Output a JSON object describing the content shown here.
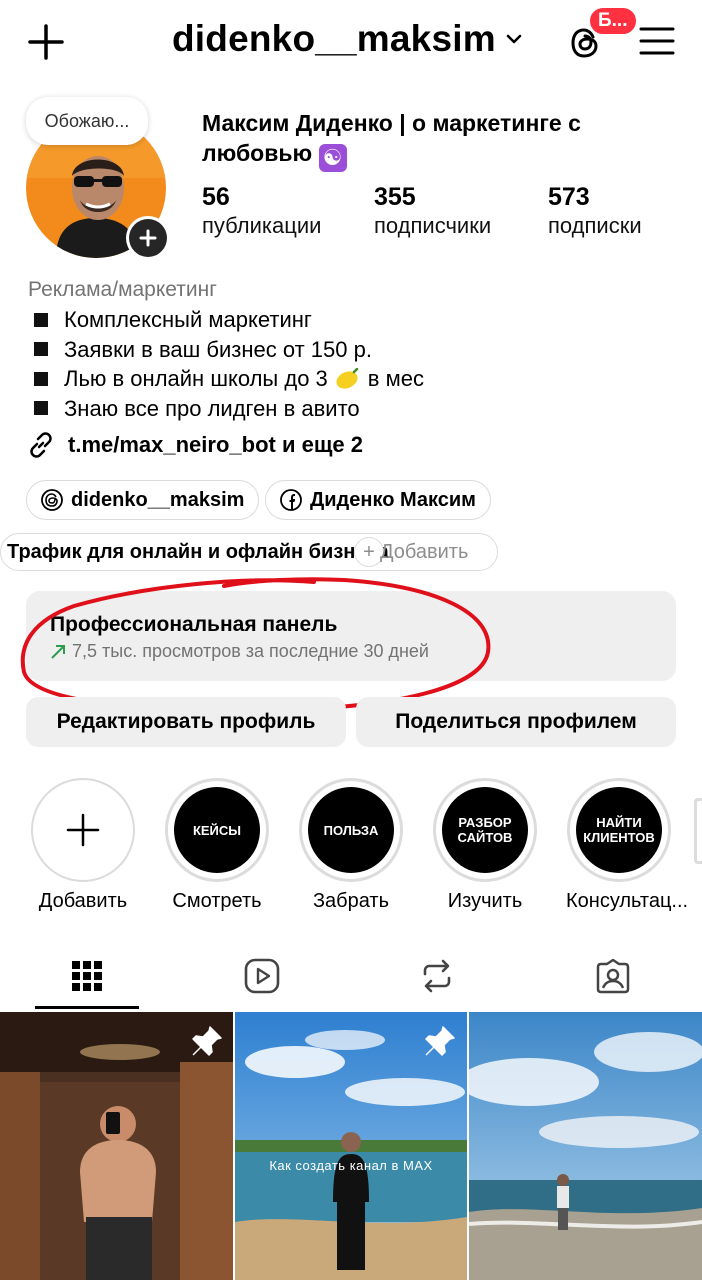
{
  "header": {
    "username": "didenko__maksim",
    "badge": "Б...",
    "icons": [
      "plus-icon",
      "chevron-down-icon",
      "threads-icon",
      "menu-icon"
    ]
  },
  "profile": {
    "note": "Обожаю...",
    "full_name": "Максим Диденко | о маркетинге с любовью",
    "stats": [
      {
        "num": "56",
        "label": "публикации"
      },
      {
        "num": "355",
        "label": "подписчики"
      },
      {
        "num": "573",
        "label": "подписки"
      }
    ],
    "category": "Реклама/маркетинг",
    "bio": [
      "Комплексный маркетинг",
      "Заявки в ваш бизнес от 150 р.",
      "Лью в онлайн школы до 3",
      "Знаю все про лидген в авито"
    ],
    "bio_line3_suffix": "в мес",
    "link": "t.me/max_neiro_bot и еще 2",
    "chips": [
      {
        "label": "didenko__maksim",
        "icon": "threads-icon"
      },
      {
        "label": "Диденко Максим",
        "icon": "facebook-icon"
      }
    ],
    "promo_text": "Трафик для онлайн и офлайн бизнеса",
    "promo_add": "Добавить"
  },
  "pro_panel": {
    "title": "Профессиональная панель",
    "subtitle": "7,5 тыс. просмотров за последние 30 дней"
  },
  "actions": {
    "edit": "Редактировать профиль",
    "share": "Поделиться профилем"
  },
  "highlights": [
    {
      "cover": "",
      "label": "Добавить"
    },
    {
      "cover": "КЕЙСЫ",
      "label": "Смотреть"
    },
    {
      "cover": "ПОЛЬЗА",
      "label": "Забрать"
    },
    {
      "cover": "РАЗБОР\nСАЙТОВ",
      "label": "Изучить"
    },
    {
      "cover": "НАЙТИ\nКЛИЕНТОВ",
      "label": "Консультац..."
    }
  ],
  "tabs": [
    "grid-icon",
    "reels-icon",
    "reposts-icon",
    "tagged-icon"
  ],
  "posts": [
    {
      "pinned": true,
      "overlay": ""
    },
    {
      "pinned": true,
      "overlay": "Как создать канал в MAX"
    },
    {
      "pinned": false,
      "overlay": ""
    }
  ],
  "colors": {
    "accent_red": "#ff3040",
    "button_bg": "#efefef",
    "secondary_text": "#737373",
    "trend_green": "#2e9b4e"
  }
}
